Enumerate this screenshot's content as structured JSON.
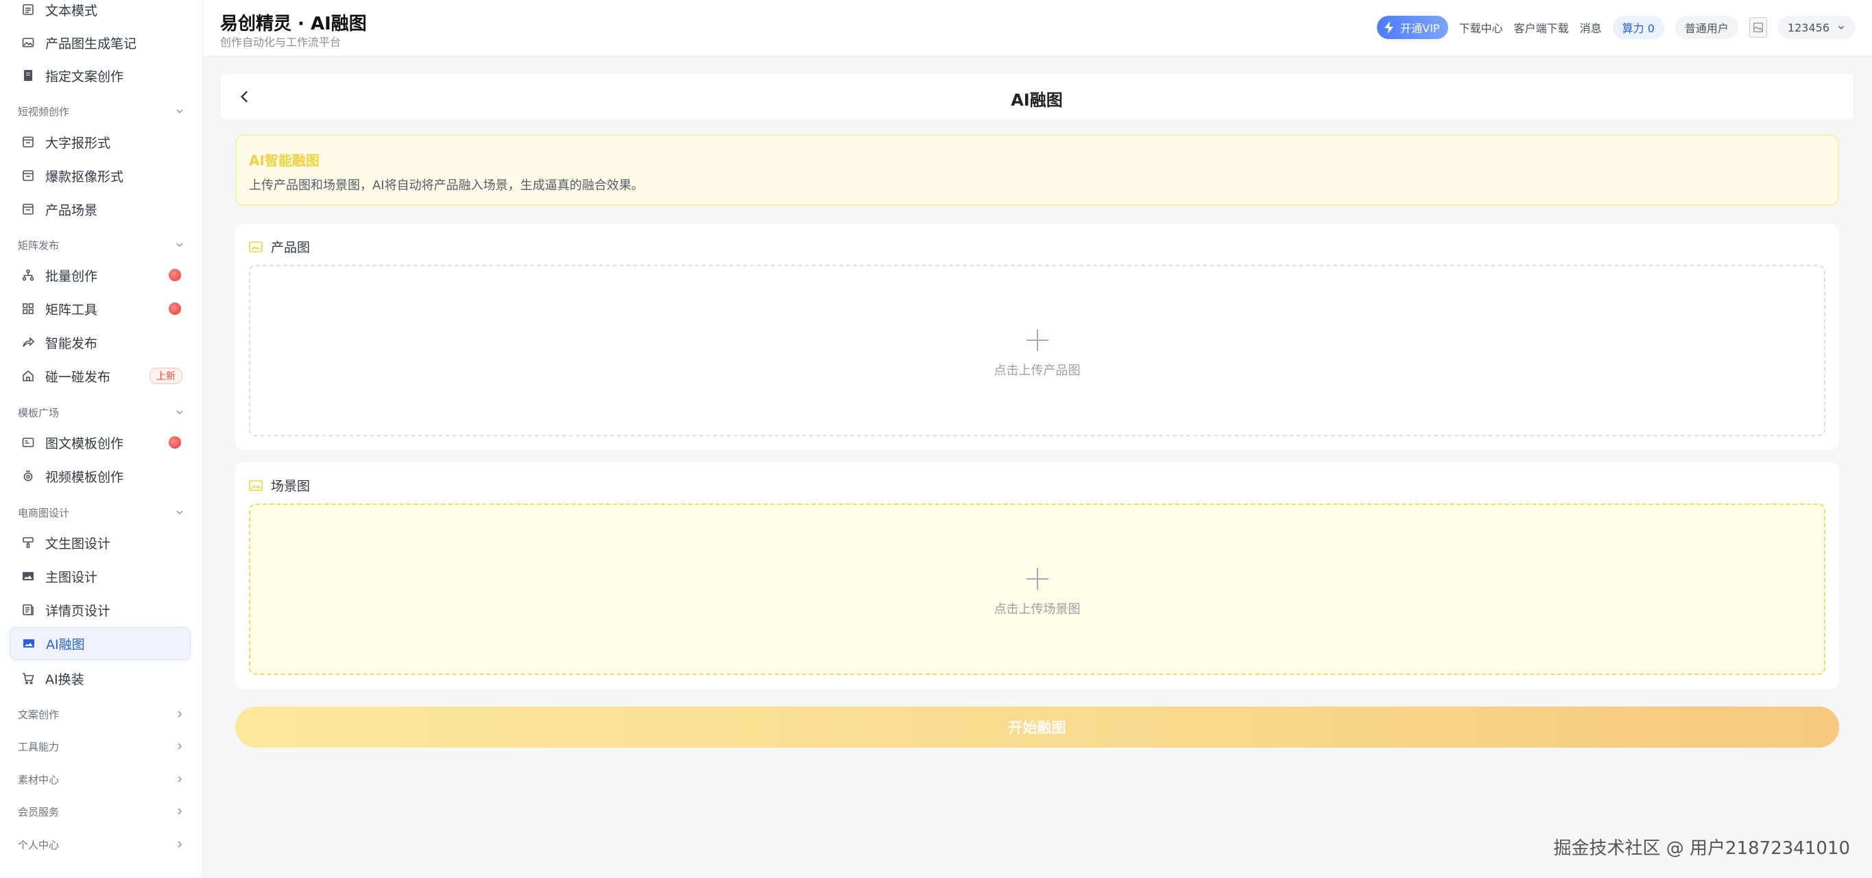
{
  "header": {
    "title": "易创精灵 · AI融图",
    "subtitle": "创作自动化与工作流平台",
    "vip_label": "开通VIP",
    "download_center": "下载中心",
    "client_download": "客户端下载",
    "messages": "消息",
    "power": "算力 0",
    "user_level": "普通用户",
    "username": "123456"
  },
  "sidebar": {
    "items": [
      {
        "label": "文本模式",
        "icon": "doc-icon"
      },
      {
        "label": "产品图生成笔记",
        "icon": "image-icon"
      },
      {
        "label": "指定文案创作",
        "icon": "notebook-icon"
      },
      {
        "group": "短视频创作"
      },
      {
        "label": "大字报形式",
        "icon": "calendar-icon"
      },
      {
        "label": "爆款抠像形式",
        "icon": "calendar-icon"
      },
      {
        "label": "产品场景",
        "icon": "calendar-icon"
      },
      {
        "group": "矩阵发布"
      },
      {
        "label": "批量创作",
        "icon": "org-icon"
      },
      {
        "label": "矩阵工具",
        "icon": "grid-icon"
      },
      {
        "label": "智能发布",
        "icon": "share-icon"
      },
      {
        "label": "碰一碰发布",
        "icon": "home-icon",
        "badge": "上新"
      },
      {
        "group": "模板广场"
      },
      {
        "label": "图文模板创作",
        "icon": "card-icon"
      },
      {
        "label": "视频模板创作",
        "icon": "video-icon"
      },
      {
        "group": "电商图设计"
      },
      {
        "label": "文生图设计",
        "icon": "brush-icon"
      },
      {
        "label": "主图设计",
        "icon": "photo-icon"
      },
      {
        "label": "详情页设计",
        "icon": "list-icon"
      },
      {
        "label": "AI融图",
        "icon": "photo-icon"
      },
      {
        "label": "AI换装",
        "icon": "cart-icon"
      },
      {
        "group": "文案创作"
      },
      {
        "group": "工具能力"
      },
      {
        "group": "素材中心"
      },
      {
        "group": "会员服务"
      },
      {
        "group": "个人中心"
      }
    ]
  },
  "main": {
    "page_title": "AI融图",
    "info_title": "AI智能融图",
    "info_desc": "上传产品图和场景图，AI将自动将产品融入场景，生成逼真的融合效果。",
    "product_label": "产品图",
    "product_upload_text": "点击上传产品图",
    "scene_label": "场景图",
    "scene_upload_text": "点击上传场景图",
    "start_button": "开始融图"
  },
  "watermark": "掘金技术社区 @ 用户21872341010",
  "colors": {
    "accent": "#2b5fd9",
    "yellow": "#f2d23c",
    "button_gradient_start": "#fde89a",
    "button_gradient_end": "#f6c97e"
  }
}
